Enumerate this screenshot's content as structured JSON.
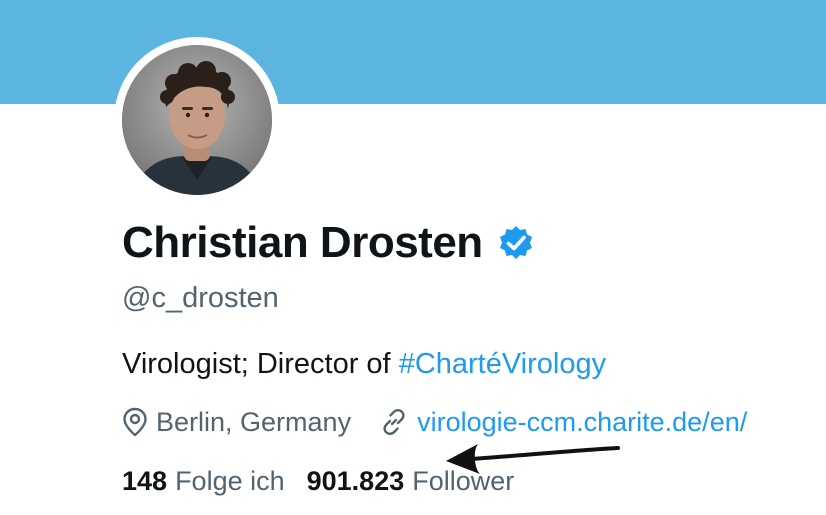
{
  "profile": {
    "display_name": "Christian Drosten",
    "handle": "@c_drosten",
    "bio_prefix": "Virologist; Director of ",
    "bio_hashtag": "#ChartéVirology",
    "location": "Berlin, Germany",
    "website": "virologie-ccm.charite.de/en/",
    "following_count": "148",
    "following_label": "Folge ich",
    "followers_count": "901.823",
    "followers_label": "Follower"
  },
  "icons": {
    "verified": "verified-badge-icon",
    "location": "location-pin-icon",
    "link": "link-icon",
    "annotation": "arrow-annotation"
  },
  "colors": {
    "banner": "#5cb5e1",
    "accent": "#1d9bf0",
    "text_primary": "#0f1419",
    "text_secondary": "#536471"
  }
}
